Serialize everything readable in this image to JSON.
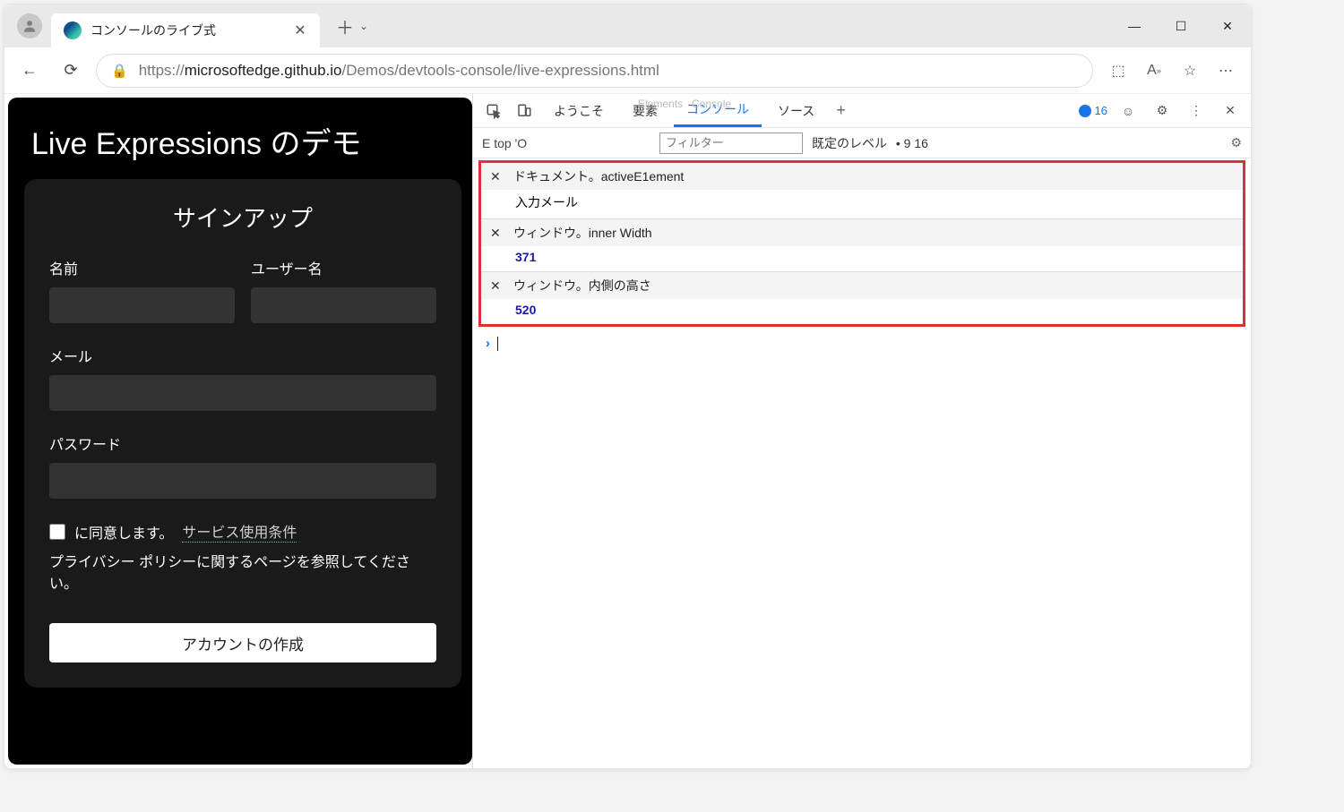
{
  "browser": {
    "tab_title": "コンソールのライブ式",
    "url_prefix": "https://",
    "url_host": "microsoftedge.github.io",
    "url_path": "/Demos/devtools-console/live-expressions.html"
  },
  "page": {
    "title": "Live Expressions のデモ",
    "signup_heading": "サインアップ",
    "name_label": "名前",
    "username_label": "ユーザー名",
    "email_label": "メール",
    "password_label": "パスワード",
    "agree_text": "に同意します。",
    "tos_link": "サービス使用条件",
    "policy_note": "プライバシー ポリシーに関するページを参照してください。",
    "submit_label": "アカウントの作成"
  },
  "devtools": {
    "tabs": {
      "welcome": "ようこそ",
      "elements_ghost": "Elements",
      "elements": "要素",
      "console_ghost": "Console",
      "console": "コンソール",
      "sources": "ソース"
    },
    "issues_count": "16",
    "context_label": "E top 'O",
    "filter_placeholder": "フィルター",
    "level_label": "既定のレベル",
    "level_badge": "• 9 16",
    "live": [
      {
        "expr": "ドキュメント。activeE1ement",
        "value_text": "入力メール",
        "value_kind": "text"
      },
      {
        "expr": "ウィンドウ。inner Width",
        "value_text": "371",
        "value_kind": "number"
      },
      {
        "expr": "ウィンドウ。内側の高さ",
        "value_text": "520",
        "value_kind": "number"
      }
    ]
  }
}
